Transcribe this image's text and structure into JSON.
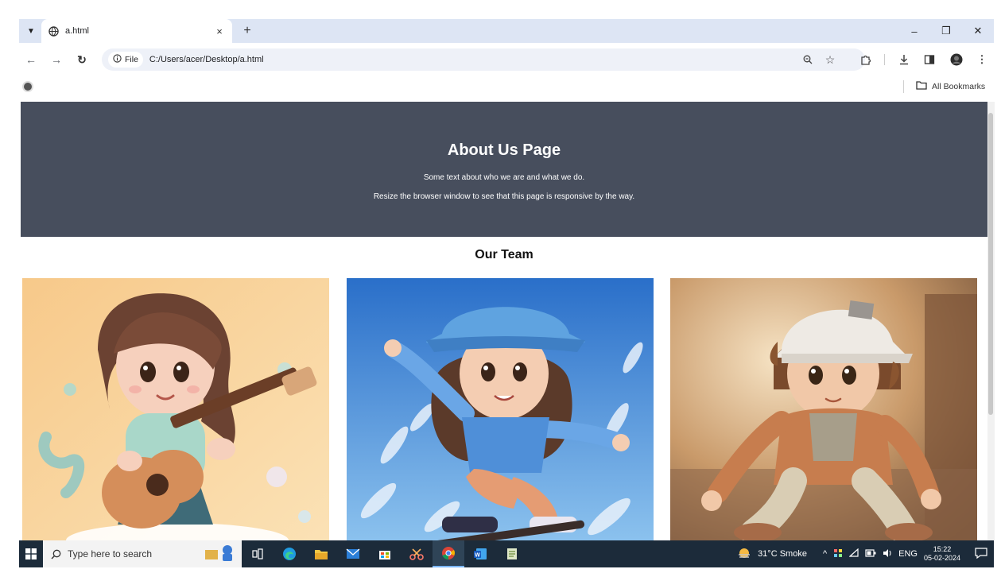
{
  "browser": {
    "tab_title": "a.html",
    "tab_close": "×",
    "new_tab": "+",
    "window_controls": {
      "minimize": "–",
      "restore": "❐",
      "close": "✕"
    },
    "site_chip": "File",
    "url": "C:/Users/acer/Desktop/a.html",
    "bookmarks_all": "All Bookmarks"
  },
  "page": {
    "hero": {
      "title": "About Us Page",
      "line1": "Some text about who we are and what we do.",
      "line2": "Resize the browser window to see that this page is responsive by the way."
    },
    "team_title": "Our Team",
    "cards": [
      {
        "image": "girl-with-guitar-3d-illustration"
      },
      {
        "image": "girl-skateboarding-3d-illustration"
      },
      {
        "image": "boy-skateboarding-3d-illustration"
      }
    ]
  },
  "taskbar": {
    "search_placeholder": "Type here to search",
    "weather": "31°C  Smoke",
    "language": "ENG",
    "time": "15:22",
    "date": "05-02-2024"
  },
  "colors": {
    "hero_bg": "#474e5d",
    "tabstrip_bg": "#dde5f4",
    "taskbar_bg": "#1c2b3a"
  }
}
